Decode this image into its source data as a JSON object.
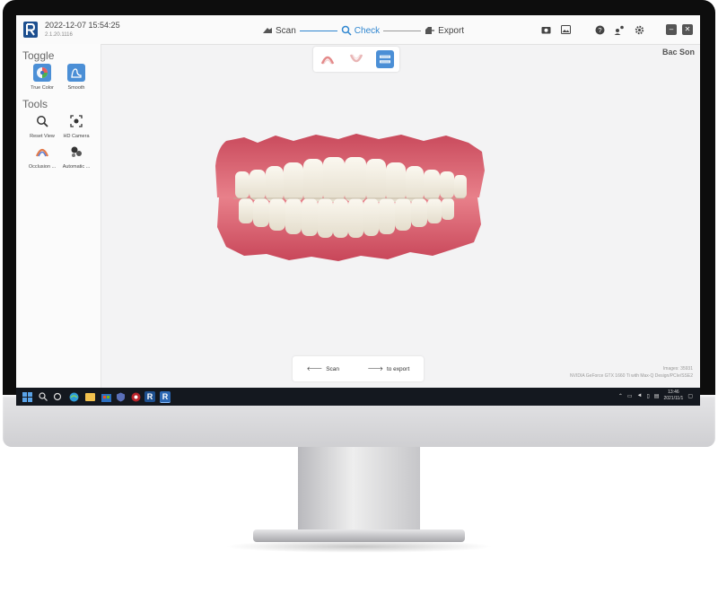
{
  "titlebar": {
    "datetime": "2022-12-07 15:54:25",
    "version": "2.1.20.1116",
    "steps": [
      {
        "label": "Scan",
        "icon": "scanner-icon",
        "active": false
      },
      {
        "label": "Check",
        "icon": "check-magnifier-icon",
        "active": true
      },
      {
        "label": "Export",
        "icon": "export-icon",
        "active": false
      }
    ]
  },
  "sidebar": {
    "toggle_heading": "Toggle",
    "toggle_items": [
      {
        "label": "True Color",
        "icon": "true-color-icon"
      },
      {
        "label": "Smooth",
        "icon": "smooth-icon"
      }
    ],
    "tools_heading": "Tools",
    "tool_items": [
      {
        "label": "Reset View",
        "icon": "reset-view-icon"
      },
      {
        "label": "HD Camera",
        "icon": "hd-camera-icon"
      },
      {
        "label": "Occlusion ...",
        "icon": "occlusion-icon"
      },
      {
        "label": "Automatic ...",
        "icon": "automatic-icon"
      }
    ]
  },
  "patient_name": "Bac Son",
  "bottom_bar": {
    "scan_label": "Scan",
    "export_label": "to export"
  },
  "info": {
    "images": "Images: 35931",
    "gpu": "NVIDIA GeForce GTX 1660 Ti with Max-Q Design/PCIe/SSE2"
  },
  "taskbar": {
    "time": "13:46",
    "date": "2021/11/1"
  },
  "colors": {
    "accent": "#2f86d0",
    "button_active": "#4b8fd6",
    "taskbar": "#14181f",
    "gingiva": "#d65a6a",
    "teeth": "#f4efe4"
  }
}
